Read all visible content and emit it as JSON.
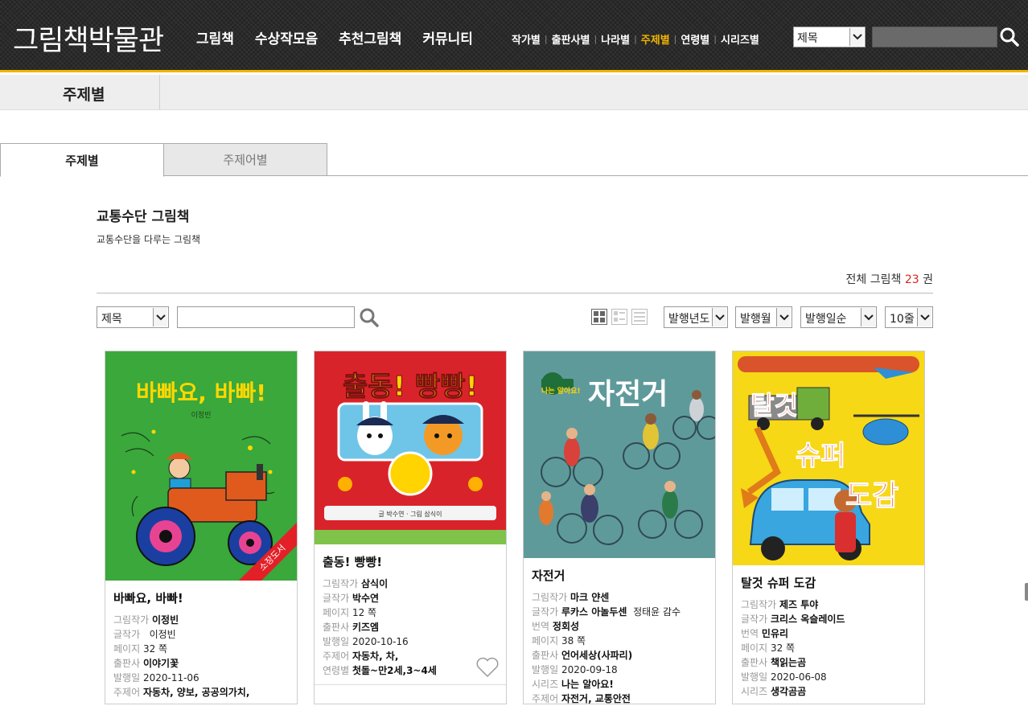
{
  "header": {
    "logo": "그림책박물관",
    "main_nav": [
      "그림책",
      "수상작모음",
      "추천그림책",
      "커뮤니티"
    ],
    "sub_nav": [
      "작가별",
      "출판사별",
      "나라별",
      "주제별",
      "연령별",
      "시리즈별"
    ],
    "sub_nav_active": "주제별",
    "search_select": "제목",
    "search_placeholder": ""
  },
  "titlebar": {
    "title": "주제별"
  },
  "tabs": [
    {
      "label": "주제별",
      "active": true
    },
    {
      "label": "주제어별",
      "active": false
    }
  ],
  "section": {
    "title": "교통수단 그림책",
    "description": "교통수단을 다루는 그림책",
    "total_prefix": "전체 그림책",
    "total_count": "23",
    "total_suffix": "권"
  },
  "filters": {
    "field_select": "제목",
    "keyword": "",
    "sort_year": "발행년도",
    "sort_month": "발행월",
    "sort_order": "발행일순",
    "per_page": "10줄"
  },
  "colors": {
    "accent": "#f1b400",
    "count": "#d8261e"
  },
  "books": [
    {
      "title": "바빠요, 바빠!",
      "cover_title": "바빠요, 바빠!",
      "cover_author": "이정빈",
      "ribbon": "소장도서",
      "rows": [
        {
          "k": "그림작가",
          "v": "이정빈"
        },
        {
          "k": "글작가",
          "v": "이정빈"
        },
        {
          "k": "페이지",
          "v": "32 쪽"
        },
        {
          "k": "출판사",
          "v": "이야기꽃"
        },
        {
          "k": "발행일",
          "v": "2020-11-06"
        },
        {
          "k": "주제어",
          "v": "자동차, 양보, 공공의가치,"
        }
      ]
    },
    {
      "title": "출동! 빵빵!",
      "cover_title": "출동! 빵빵!",
      "cover_author": "글 박수연 · 그림 삼식이",
      "rows": [
        {
          "k": "그림작가",
          "v": "삼식이"
        },
        {
          "k": "글작가",
          "v": "박수연"
        },
        {
          "k": "페이지",
          "v": "12 쪽"
        },
        {
          "k": "출판사",
          "v": "키즈엠"
        },
        {
          "k": "발행일",
          "v": "2020-10-16"
        },
        {
          "k": "주제어",
          "v": "자동차, 차,"
        },
        {
          "k": "연령별",
          "v": "첫돌~만2세,3~4세"
        }
      ]
    },
    {
      "title": "자전거",
      "cover_title": "자전거",
      "cover_badge": "나는 알아요!",
      "rows": [
        {
          "k": "그림작가",
          "v": "마크 얀센"
        },
        {
          "k": "글작가",
          "v": "루카스 아놀두센",
          "extra": "정태윤 감수"
        },
        {
          "k": "번역",
          "v": "정회성"
        },
        {
          "k": "페이지",
          "v": "38 쪽"
        },
        {
          "k": "출판사",
          "v": "언어세상(사파리)"
        },
        {
          "k": "발행일",
          "v": "2020-09-18"
        },
        {
          "k": "시리즈",
          "v": "나는 알아요!"
        },
        {
          "k": "주제어",
          "v": "자전거, 교통안전"
        }
      ]
    },
    {
      "title": "탈것 슈퍼 도감",
      "cover_title_1": "탈것",
      "cover_title_2": "슈퍼",
      "cover_title_3": "도감",
      "rows": [
        {
          "k": "그림작가",
          "v": "제즈 투야"
        },
        {
          "k": "글작가",
          "v": "크리스 옥슬레이드"
        },
        {
          "k": "번역",
          "v": "민유리"
        },
        {
          "k": "페이지",
          "v": "32 쪽"
        },
        {
          "k": "출판사",
          "v": "책읽는곰"
        },
        {
          "k": "발행일",
          "v": "2020-06-08"
        },
        {
          "k": "시리즈",
          "v": "생각곰곰"
        }
      ]
    }
  ]
}
